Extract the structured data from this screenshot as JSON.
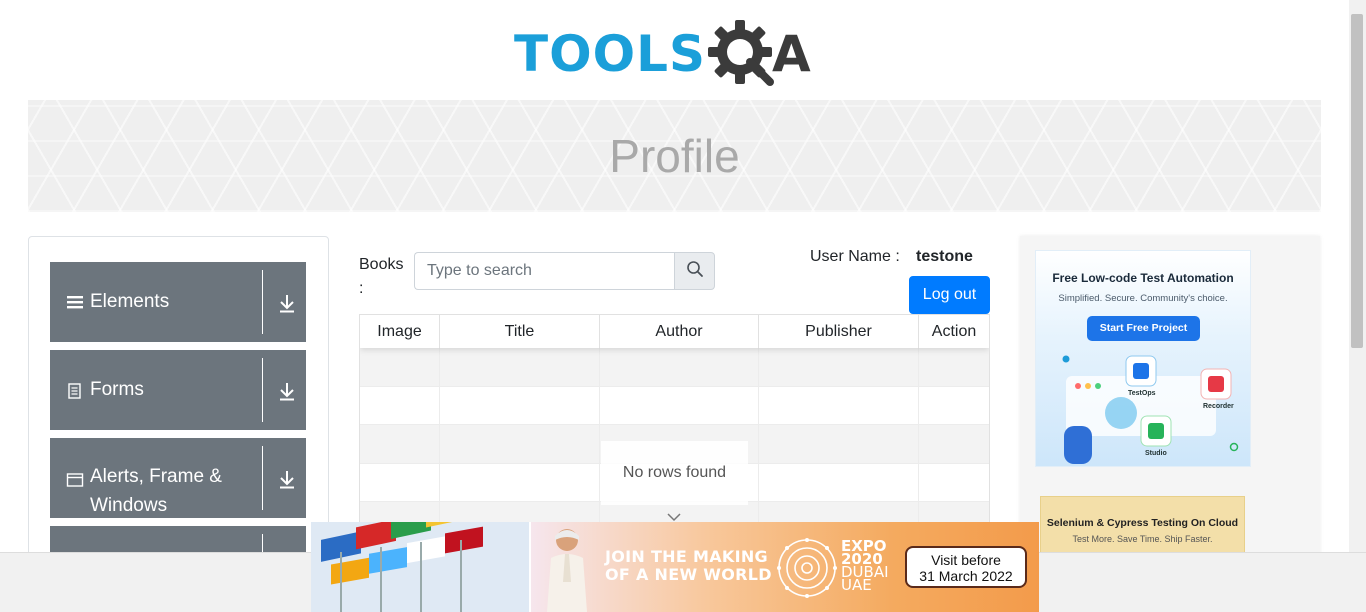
{
  "header": {
    "logo_text": "TOOLSQA",
    "logo_part1": "TOOLS",
    "logo_part2": "A"
  },
  "banner": {
    "title": "Profile"
  },
  "sidebar": {
    "groups": [
      {
        "label": "Elements",
        "icon": "hamburger-icon"
      },
      {
        "label": "Forms",
        "icon": "document-icon"
      },
      {
        "label": "Alerts, Frame & Windows",
        "icon": "window-icon"
      },
      {
        "label": "",
        "icon": ""
      }
    ]
  },
  "books": {
    "label": "Books :",
    "search_placeholder": "Type to search",
    "search_value": ""
  },
  "user": {
    "label": "User Name :",
    "value": "testone",
    "logout_label": "Log out"
  },
  "table": {
    "columns": [
      "Image",
      "Title",
      "Author",
      "Publisher",
      "Action"
    ],
    "empty_text": "No rows found"
  },
  "ads": {
    "ad1": {
      "title": "Free Low-code Test Automation",
      "subtitle": "Simplified. Secure. Community's choice.",
      "button": "Start Free Project",
      "labels": [
        "TestOps",
        "Recorder",
        "Studio"
      ]
    },
    "ad2": {
      "title": "Selenium & Cypress Testing On Cloud",
      "subtitle": "Test More. Save Time. Ship Faster."
    },
    "expo": {
      "line1": "JOIN THE MAKING",
      "line2": "OF A NEW WORLD",
      "brand": [
        "EXPO",
        "2020",
        "DUBAI",
        "UAE"
      ],
      "visit_line1": "Visit before",
      "visit_line2": "31 March 2022"
    }
  },
  "colors": {
    "brand_blue": "#1b9fd9",
    "accordion_bg": "#6c757d",
    "primary_button": "#007bff"
  }
}
